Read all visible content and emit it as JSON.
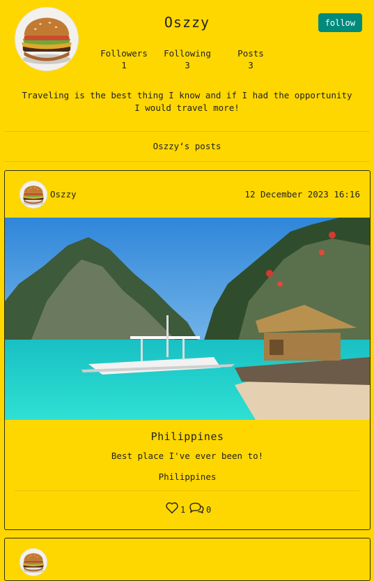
{
  "profile": {
    "username": "Oszzy",
    "follow_label": "follow",
    "stats": [
      {
        "label": "Followers",
        "value": "1"
      },
      {
        "label": "Following",
        "value": "3"
      },
      {
        "label": "Posts",
        "value": "3"
      }
    ],
    "bio": "Traveling is the best thing I know and if I had the opportunity I would travel more!"
  },
  "posts_heading": "Oszzy‘s posts",
  "posts": [
    {
      "author": "Oszzy",
      "date": "12 December 2023 16:16",
      "title": "Philippines",
      "description": "Best place I've ever been to!",
      "location": "Philippines",
      "likes": "1",
      "comments": "0"
    }
  ],
  "icons": [
    "burger-avatar-icon",
    "heart-icon",
    "comment-icon"
  ],
  "colors": {
    "background": "#ffd700",
    "follow_button": "#008a7c",
    "text": "#222222"
  }
}
